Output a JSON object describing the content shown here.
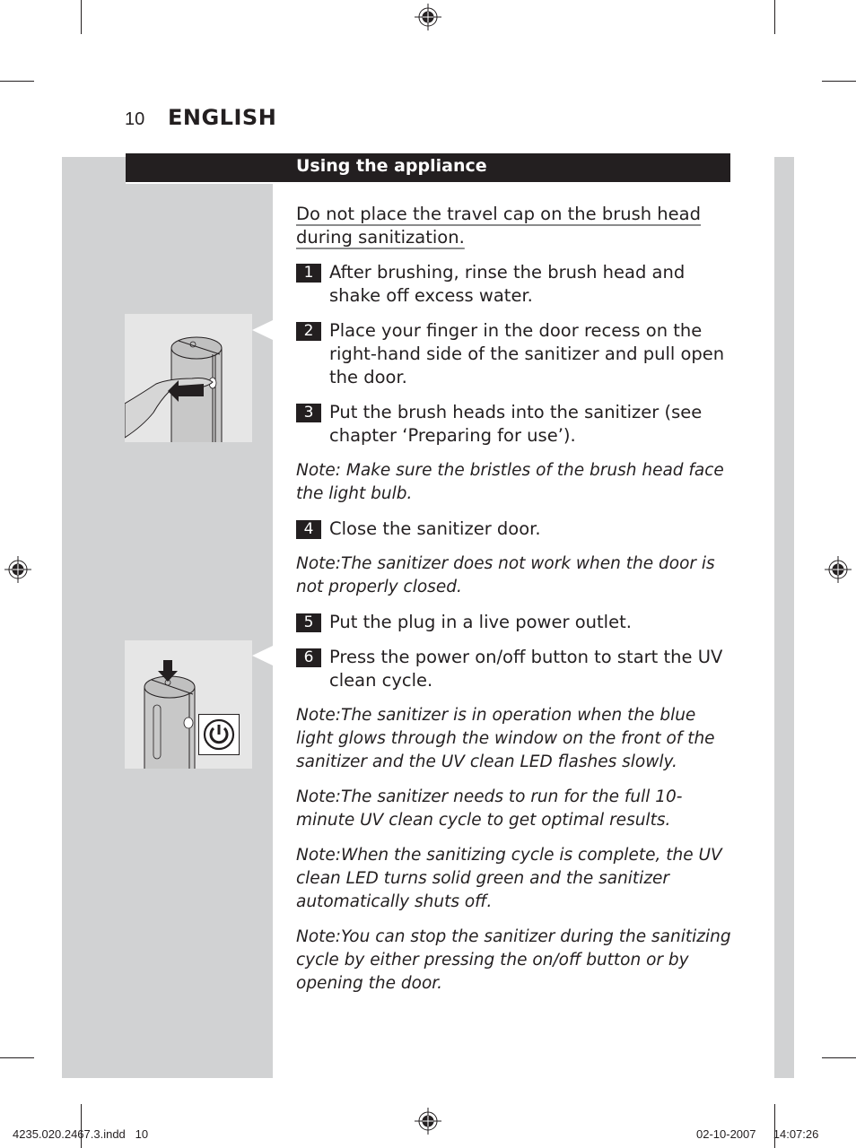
{
  "page": {
    "number": "10",
    "language": "ENGLISH",
    "section_title": "Using the appliance"
  },
  "content": {
    "warning": "Do not place the travel cap on the brush head during sanitization.",
    "steps": [
      {
        "num": "1",
        "text": "After brushing, rinse the brush head and shake off excess water."
      },
      {
        "num": "2",
        "text": "Place your finger in the door recess on the right-hand side of the sanitizer and pull open the door."
      },
      {
        "num": "3",
        "text": "Put the brush heads into the sanitizer (see chapter ‘Preparing for use’)."
      },
      {
        "num": "4",
        "text": "Close the sanitizer door."
      },
      {
        "num": "5",
        "text": "Put the plug in a live power outlet."
      },
      {
        "num": "6",
        "text": "Press the power on/off button to start the UV clean cycle."
      }
    ],
    "notes": [
      "Note: Make sure the bristles of the brush head face the light bulb.",
      "Note:The sanitizer does not work when the door is not properly closed.",
      "Note:The sanitizer is in operation when the blue light glows through the window on the front of the sanitizer and the UV clean LED flashes slowly.",
      "Note:The sanitizer needs to run for the full 10-minute UV clean cycle to get optimal results.",
      "Note:When the sanitizing cycle is complete, the UV clean LED turns solid green and the sanitizer automatically shuts off.",
      "Note:You can stop the sanitizer during the sanitizing cycle by either pressing the on/off button or by opening the door."
    ]
  },
  "figures": [
    {
      "icon": "hand-opening-door-icon",
      "caption": ""
    },
    {
      "icon": "power-button-icon",
      "caption": ""
    }
  ],
  "footer": {
    "file": "4235.020.2467.3.indd   10",
    "date": "02-10-2007",
    "time": "14:07:26"
  },
  "colors": {
    "ink": "#231f20",
    "panel_gray": "#d1d2d3",
    "figure_bg": "#e6e6e6"
  }
}
